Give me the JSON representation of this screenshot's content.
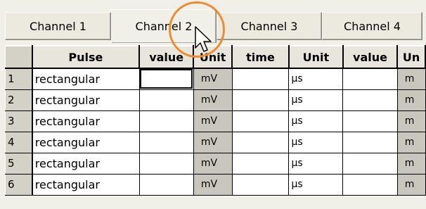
{
  "tabs": [
    {
      "label": "Channel 1"
    },
    {
      "label": "Channel 2"
    },
    {
      "label": "Channel 3"
    },
    {
      "label": "Channel 4"
    }
  ],
  "table": {
    "headers": [
      "",
      "Pulse",
      "value",
      "Unit",
      "time",
      "Unit",
      "value",
      "Un"
    ],
    "rows": [
      {
        "num": "1",
        "pulse": "rectangular",
        "value": "",
        "unit": "mV",
        "time": "",
        "tunit": "µs",
        "value2": "",
        "unit2": "m"
      },
      {
        "num": "2",
        "pulse": "rectangular",
        "value": "",
        "unit": "mV",
        "time": "",
        "tunit": "µs",
        "value2": "",
        "unit2": "m"
      },
      {
        "num": "3",
        "pulse": "rectangular",
        "value": "",
        "unit": "mV",
        "time": "",
        "tunit": "µs",
        "value2": "",
        "unit2": "m"
      },
      {
        "num": "4",
        "pulse": "rectangular",
        "value": "",
        "unit": "mV",
        "time": "",
        "tunit": "µs",
        "value2": "",
        "unit2": "m"
      },
      {
        "num": "5",
        "pulse": "rectangular",
        "value": "",
        "unit": "mV",
        "time": "",
        "tunit": "µs",
        "value2": "",
        "unit2": "m"
      },
      {
        "num": "6",
        "pulse": "rectangular",
        "value": "",
        "unit": "mV",
        "time": "",
        "tunit": "µs",
        "value2": "",
        "unit2": "m"
      }
    ]
  },
  "colors": {
    "highlight_ring": "#f08a2c",
    "unit_column": "#c9c7bd"
  },
  "icons": [
    "mouse-cursor-icon"
  ]
}
